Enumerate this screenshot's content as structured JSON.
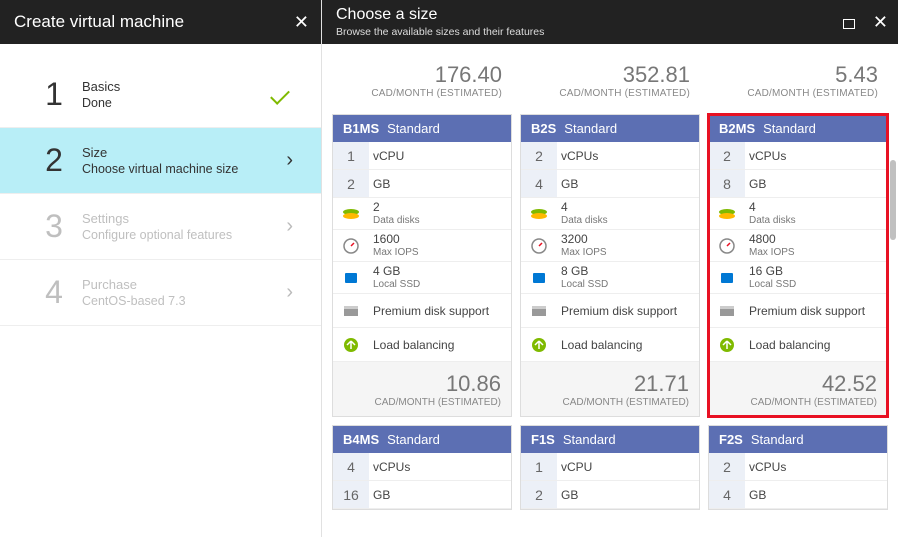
{
  "leftHeader": "Create virtual machine",
  "rightHeader": {
    "title": "Choose a size",
    "subtitle": "Browse the available sizes and their features"
  },
  "steps": [
    {
      "num": "1",
      "title": "Basics",
      "subtitle": "Done",
      "state": "done"
    },
    {
      "num": "2",
      "title": "Size",
      "subtitle": "Choose virtual machine size",
      "state": "active"
    },
    {
      "num": "3",
      "title": "Settings",
      "subtitle": "Configure optional features",
      "state": "disabled"
    },
    {
      "num": "4",
      "title": "Purchase",
      "subtitle": "CentOS-based 7.3",
      "state": "disabled"
    }
  ],
  "topPrices": [
    {
      "price": "176.40",
      "unit": "CAD/MONTH (ESTIMATED)"
    },
    {
      "price": "352.81",
      "unit": "CAD/MONTH (ESTIMATED)"
    },
    {
      "price": "5.43",
      "unit": "CAD/MONTH (ESTIMATED)"
    }
  ],
  "cards": [
    {
      "code": "B1MS",
      "tier": "Standard",
      "selected": false,
      "vcpu": "1",
      "vcpuLabel": "vCPU",
      "gb": "2",
      "gbLabel": "GB",
      "disks": "2",
      "disksLabel": "Data disks",
      "iops": "1600",
      "iopsLabel": "Max IOPS",
      "ssd": "4 GB",
      "ssdLabel": "Local SSD",
      "feat1": "Premium disk support",
      "feat2": "Load balancing",
      "botPrice": "10.86",
      "botUnit": "CAD/MONTH (ESTIMATED)"
    },
    {
      "code": "B2S",
      "tier": "Standard",
      "selected": false,
      "vcpu": "2",
      "vcpuLabel": "vCPUs",
      "gb": "4",
      "gbLabel": "GB",
      "disks": "4",
      "disksLabel": "Data disks",
      "iops": "3200",
      "iopsLabel": "Max IOPS",
      "ssd": "8 GB",
      "ssdLabel": "Local SSD",
      "feat1": "Premium disk support",
      "feat2": "Load balancing",
      "botPrice": "21.71",
      "botUnit": "CAD/MONTH (ESTIMATED)"
    },
    {
      "code": "B2MS",
      "tier": "Standard",
      "selected": true,
      "vcpu": "2",
      "vcpuLabel": "vCPUs",
      "gb": "8",
      "gbLabel": "GB",
      "disks": "4",
      "disksLabel": "Data disks",
      "iops": "4800",
      "iopsLabel": "Max IOPS",
      "ssd": "16 GB",
      "ssdLabel": "Local SSD",
      "feat1": "Premium disk support",
      "feat2": "Load balancing",
      "botPrice": "42.52",
      "botUnit": "CAD/MONTH (ESTIMATED)"
    }
  ],
  "cardsRow2": [
    {
      "code": "B4MS",
      "tier": "Standard",
      "vcpu": "4",
      "vcpuLabel": "vCPUs",
      "gb": "16",
      "gbLabel": "GB"
    },
    {
      "code": "F1S",
      "tier": "Standard",
      "vcpu": "1",
      "vcpuLabel": "vCPU",
      "gb": "2",
      "gbLabel": "GB"
    },
    {
      "code": "F2S",
      "tier": "Standard",
      "vcpu": "2",
      "vcpuLabel": "vCPUs",
      "gb": "4",
      "gbLabel": "GB"
    }
  ]
}
